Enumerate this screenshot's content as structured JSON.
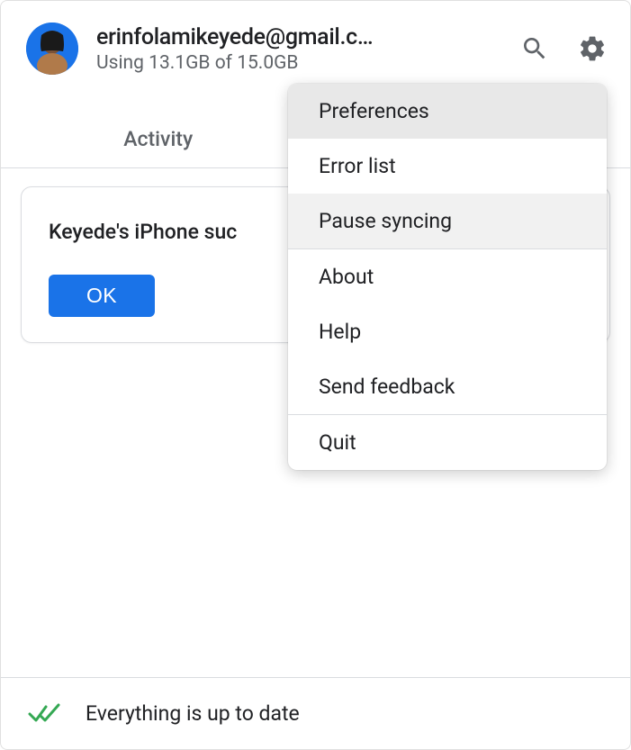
{
  "header": {
    "email": "erinfolamikeyede@gmail.c…",
    "storage": "Using 13.1GB of 15.0GB"
  },
  "tabs": {
    "activity": "Activity"
  },
  "card": {
    "title": "Keyede's iPhone suc",
    "ok": "OK"
  },
  "menu": {
    "preferences": "Preferences",
    "error_list": "Error list",
    "pause_syncing": "Pause syncing",
    "about": "About",
    "help": "Help",
    "send_feedback": "Send feedback",
    "quit": "Quit"
  },
  "footer": {
    "status": "Everything is up to date"
  }
}
